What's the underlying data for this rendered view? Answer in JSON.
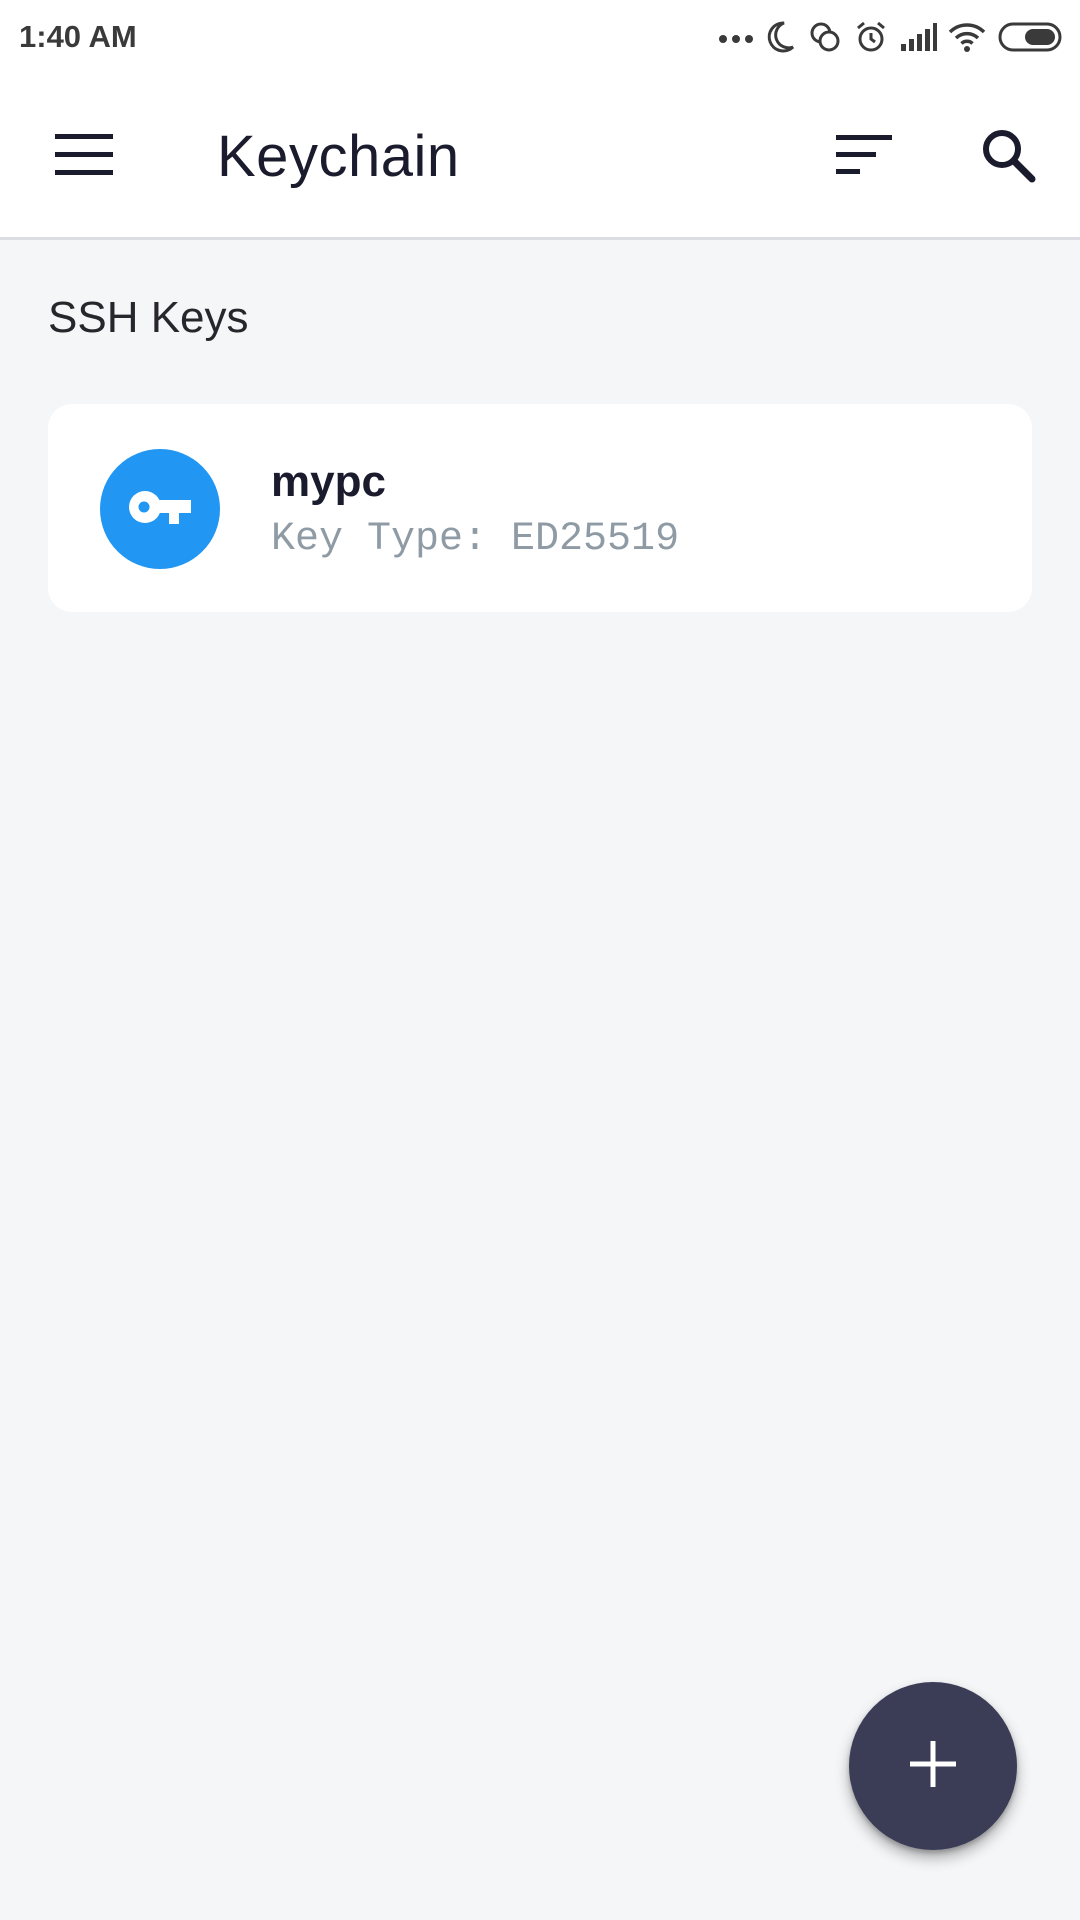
{
  "status_bar": {
    "time": "1:40 AM",
    "icons": [
      "more-dots-icon",
      "moon-icon",
      "sync-icon",
      "alarm-icon",
      "signal-icon",
      "wifi-icon",
      "battery-icon"
    ]
  },
  "app_bar": {
    "title": "Keychain",
    "icons": [
      "menu-icon",
      "sort-icon",
      "search-icon"
    ]
  },
  "section": {
    "title": "SSH Keys"
  },
  "keys": [
    {
      "name": "mypc",
      "type_line": "Key Type: ED25519",
      "icon": "key-icon"
    }
  ],
  "fab": {
    "icon": "plus-icon"
  },
  "colors": {
    "background": "#f5f6f8",
    "surface": "#ffffff",
    "accent": "#2196f3",
    "fab": "#3b3d57",
    "text_primary": "#1b1b2e",
    "text_secondary": "#8f9ba4"
  }
}
